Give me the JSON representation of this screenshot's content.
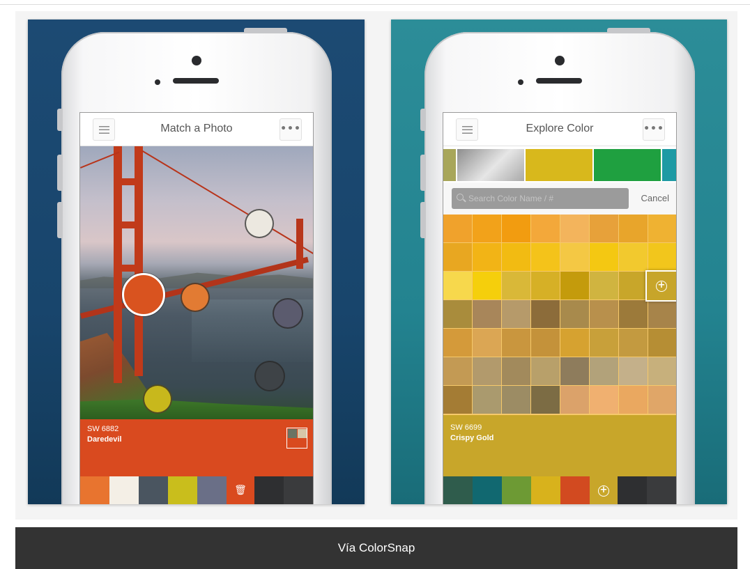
{
  "caption": "Vía ColorSnap",
  "left_phone": {
    "title": "Match a Photo",
    "menu_icon": "hamburger-icon",
    "more_icon": "ellipsis-icon",
    "more_glyph": "•••",
    "selected_color": {
      "code": "SW 6882",
      "name": "Daredevil",
      "hex": "#d94a1f"
    },
    "picked_swatches": [
      "#d9531f",
      "#e27b33",
      "#ece8e0",
      "#5b5b6e",
      "#3e4347",
      "#c8b81c"
    ],
    "palette_tray": [
      "#e8742f",
      "#f4efe6",
      "#4a5560",
      "#c9be1c",
      "#6a6f87"
    ],
    "tray_tool_icon": "trash-icon",
    "tray_tool_glyph": "🗑",
    "dark_tiles": [
      "#2e2f31",
      "#3a3b3d"
    ]
  },
  "right_phone": {
    "title": "Explore Color",
    "menu_icon": "hamburger-icon",
    "more_icon": "ellipsis-icon",
    "more_glyph": "•••",
    "strip_colors": [
      "#a8a65a",
      "#c2c2c2",
      "#d8b81c",
      "#1fa040",
      "#1e9aa4"
    ],
    "search": {
      "placeholder": "Search Color Name / #",
      "cancel_label": "Cancel"
    },
    "grid_rows": [
      [
        "#f0a22c",
        "#f2a21a",
        "#f29c10",
        "#f3a83a",
        "#f3b45c",
        "#e7a13a",
        "#e8a52b",
        "#efb232"
      ],
      [
        "#e8a721",
        "#f2b416",
        "#f2bb12",
        "#f4c31a",
        "#f4c844",
        "#f4c812",
        "#f2c92e",
        "#f2c61c"
      ],
      [
        "#f7d84c",
        "#f5cf0c",
        "#d9b838",
        "#d6b026",
        "#c49b0c",
        "#d0b440",
        "#c8a62a",
        "#c7a52a"
      ],
      [
        "#a98c3c",
        "#a8865a",
        "#b69a6a",
        "#8c6c3a",
        "#a88a4c",
        "#b8904c",
        "#9c7a3a",
        "#a7844a"
      ],
      [
        "#d49a3a",
        "#dba654",
        "#c9963e",
        "#c4923a",
        "#d6a230",
        "#c8a03a",
        "#c39a40",
        "#b68e34"
      ],
      [
        "#c39a54",
        "#b29a6c",
        "#a28a5c",
        "#b8a06a",
        "#8e7c5c",
        "#b2a27a",
        "#c4b08a",
        "#c7b07c"
      ],
      [
        "#a47c34",
        "#aa9a6e",
        "#9c8c64",
        "#7c6c44",
        "#dba26a",
        "#f0b070",
        "#eaa860",
        "#e0a668"
      ]
    ],
    "selected_color": {
      "code": "SW 6699",
      "name": "Crispy Gold",
      "hex": "#c8a62a"
    },
    "add_icon": "plus-circle-icon",
    "add_glyph": "+",
    "palette_tray": [
      "#2f5c4c",
      "#116870",
      "#6d9a34",
      "#d8b21c",
      "#d24a20"
    ],
    "dark_tiles": [
      "#2e2f31",
      "#3a3b3d"
    ]
  }
}
